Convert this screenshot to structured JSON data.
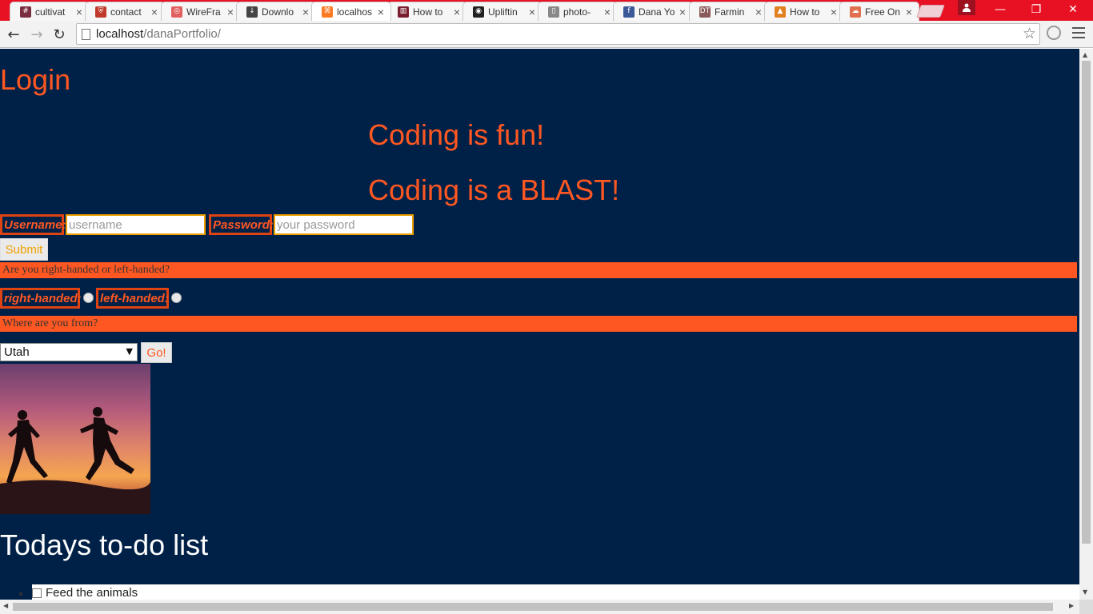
{
  "browser": {
    "tabs": [
      {
        "title": "cultivat",
        "favicon": "hash-icon",
        "favicon_color": "#7a2e40",
        "active": false
      },
      {
        "title": "contact",
        "favicon": "shield-icon",
        "favicon_color": "#c0392b",
        "active": false
      },
      {
        "title": "WireFra",
        "favicon": "wireframe-icon",
        "favicon_color": "#e06060",
        "active": false
      },
      {
        "title": "Downlo",
        "favicon": "download-icon",
        "favicon_color": "#444444",
        "active": false
      },
      {
        "title": "localhos",
        "favicon": "xampp-icon",
        "favicon_color": "#fb7a24",
        "active": true
      },
      {
        "title": "How to",
        "favicon": "trello-icon",
        "favicon_color": "#7a1e2e",
        "active": false
      },
      {
        "title": "Upliftin",
        "favicon": "camera-icon",
        "favicon_color": "#222222",
        "active": false
      },
      {
        "title": "photo-",
        "favicon": "page-icon",
        "favicon_color": "#888888",
        "active": false
      },
      {
        "title": "Dana Yo",
        "favicon": "facebook-icon",
        "favicon_color": "#3b5998",
        "active": false
      },
      {
        "title": "Farmin",
        "favicon": "dt-icon",
        "favicon_color": "#8a5a5a",
        "active": false
      },
      {
        "title": "How to",
        "favicon": "tutorial-icon",
        "favicon_color": "#e08020",
        "active": false
      },
      {
        "title": "Free On",
        "favicon": "cloud-icon",
        "favicon_color": "#e07050",
        "active": false
      }
    ],
    "url_host": "localhost",
    "url_path": "/danaPortfolio/",
    "chrome_color": "#e81123"
  },
  "page": {
    "heading": "Login",
    "slogan_1": "Coding is fun!",
    "slogan_2": "Coding is a BLAST!",
    "username_label": "Username:",
    "username_placeholder": "username",
    "password_label": "Password:",
    "password_placeholder": "your password",
    "submit_label": "Submit",
    "hand_question": "Are you right-handed or left-handed?",
    "right_label": "right-handed:",
    "left_label": "left-handed:",
    "origin_question": "Where are you from?",
    "state_selected": "Utah",
    "go_label": "Go!",
    "todo_heading": "Todays to-do list",
    "todo_items": [
      "Feed the animals"
    ],
    "colors": {
      "background": "#002147",
      "accent": "#ff5722",
      "input_border": "#f0a000"
    }
  }
}
